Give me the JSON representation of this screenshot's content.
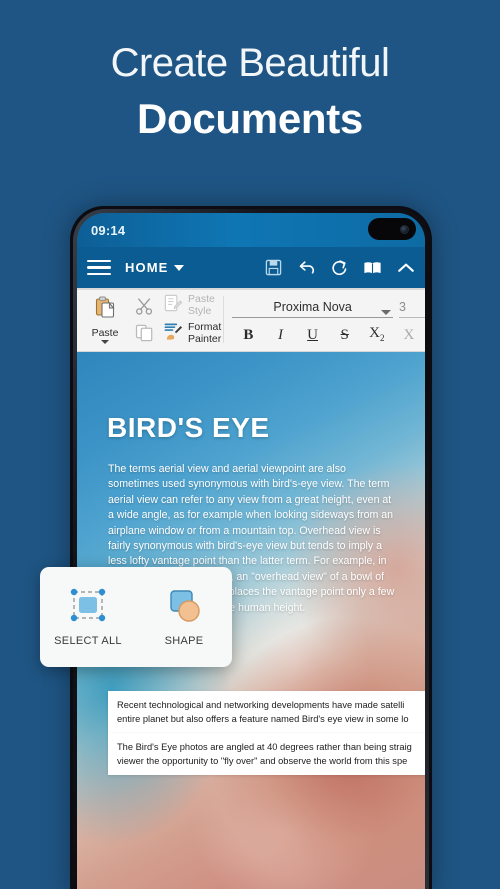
{
  "headline": {
    "line1": "Create Beautiful",
    "line2": "Documents"
  },
  "colors": {
    "background": "#1f5584",
    "toolbar": "#0b5c93",
    "statusbar": "#0f76b4",
    "ribbon": "#f4f4f4",
    "accent_blue": "#63b3dd",
    "shape_orange": "#f3c091"
  },
  "phone": {
    "statusbar": {
      "time": "09:14",
      "icons": [
        "wifi-icon",
        "cellular-signal-icon",
        "battery-icon"
      ],
      "camera": "punch-hole-camera"
    },
    "app_toolbar": {
      "menu_icon": "hamburger-menu-icon",
      "tab_label": "HOME",
      "tab_caret": "chevron-down-icon",
      "actions": [
        {
          "name": "save-icon",
          "label": "Save"
        },
        {
          "name": "undo-icon",
          "label": "Undo"
        },
        {
          "name": "redo-icon",
          "label": "Redo"
        },
        {
          "name": "read-mode-icon",
          "label": "Read Mode"
        },
        {
          "name": "collapse-ribbon-icon",
          "label": "Collapse"
        }
      ]
    },
    "ribbon": {
      "paste_label": "Paste",
      "cut_icon": "scissors-icon",
      "copy_icon": "copy-icon",
      "paste_style_label_1": "Paste",
      "paste_style_label_2": "Style",
      "format_painter_label_1": "Format",
      "format_painter_label_2": "Painter",
      "font_name": "Proxima Nova",
      "font_size": "3",
      "format_buttons": [
        {
          "name": "bold-button",
          "label": "B"
        },
        {
          "name": "italic-button",
          "label": "I"
        },
        {
          "name": "underline-button",
          "label": "U"
        },
        {
          "name": "strikethrough-button",
          "label": "S"
        },
        {
          "name": "subscript-button",
          "label": "X"
        },
        {
          "name": "clear-formatting-button",
          "label": "X"
        }
      ],
      "subscript_suffix": "2"
    },
    "document": {
      "title": "BIRD'S EYE",
      "body": "The terms aerial view and aerial viewpoint are also sometimes used synonymous with bird's-eye view. The term aerial view can refer to any view from a great height, even at a wide angle, as for example when looking sideways from an airplane window or from a mountain top. Overhead view is fairly synonymous with bird's-eye view but tends to imply a less lofty vantage point than the latter term. For example, in purely photographic terms, an \"overhead view\" of a bowl of soup may be taken when places the vantage point only a few feet (a meter or two) above human height.",
      "white_box_1": {
        "line1": "Recent technological and networking developments have made satelli",
        "line2": "entire planet but also offers a feature named Bird's eye view in some lo"
      },
      "white_box_2": {
        "line1": "The Bird's Eye photos are angled at 40 degrees rather than being straig",
        "line2": "viewer the opportunity to \"fly over\" and observe the world from this spe"
      }
    },
    "popup": {
      "items": [
        {
          "icon": "select-all-icon",
          "label_1": "SELECT",
          "label_2": "ALL"
        },
        {
          "icon": "shape-icon",
          "label_1": "SHAPE",
          "label_2": ""
        }
      ]
    }
  }
}
